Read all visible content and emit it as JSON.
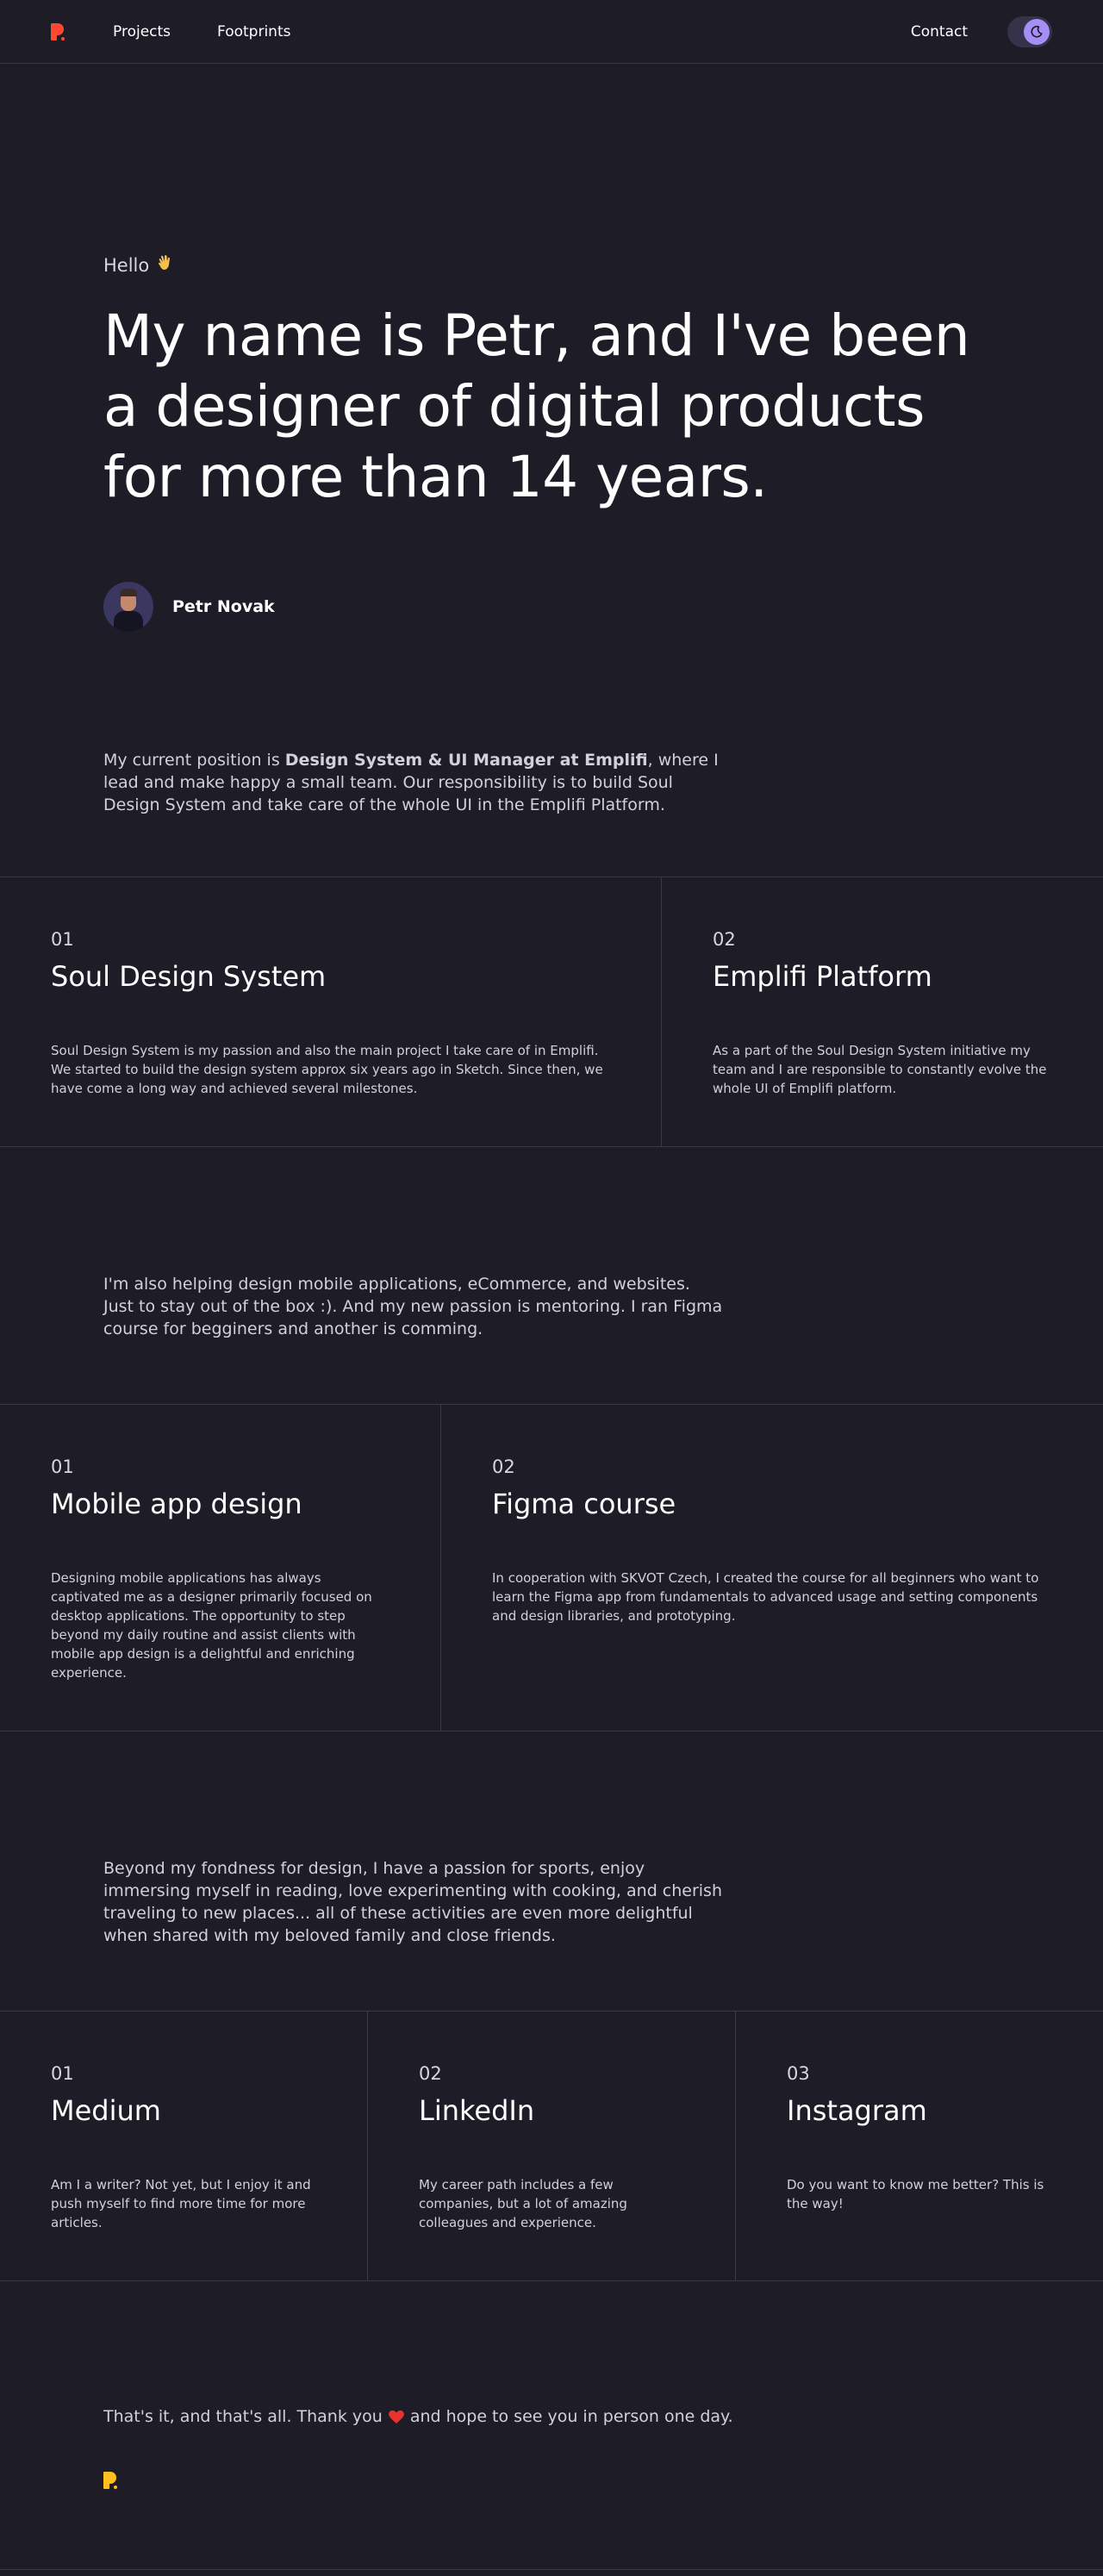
{
  "nav": {
    "links": [
      {
        "label": "Projects"
      },
      {
        "label": "Footprints"
      }
    ],
    "contact_label": "Contact",
    "logo_color": "#ff4830",
    "toggle_color": "#a58ef5"
  },
  "hero": {
    "greeting": "Hello",
    "greeting_icon": "waving-hand-icon",
    "headline": "My name is Petr, and I've been a designer of digital products for more than 14 years.",
    "author_name": "Petr Novak"
  },
  "intro": {
    "before": "My current position is ",
    "bold": "Design System & UI Manager at Emplifi",
    "after": ", where I lead and make happy a small team. Our responsibility is to build Soul Design System and take care of the whole UI in the Emplifi Platform."
  },
  "section1": [
    {
      "num": "01",
      "title": "Soul Design System",
      "text": "Soul Design System is my passion and also the main project I take care of in Emplifi. We started to build the design system approx six years ago in Sketch. Since then, we have come a long way and achieved several milestones."
    },
    {
      "num": "02",
      "title": "Emplifi Platform",
      "text": "As a part of the Soul Design System initiative my team and I are responsible to constantly evolve the whole UI of Emplifi platform."
    }
  ],
  "text2": "I'm also helping design mobile applications, eCommerce, and websites. Just to stay out of the box :). And my new passion is mentoring. I ran Figma course for begginers and another is comming.",
  "section2": [
    {
      "num": "01",
      "title": "Mobile app design",
      "text": "Designing mobile applications has always captivated me as a designer primarily focused on desktop applications. The opportunity to step beyond my daily routine and assist clients with mobile app design is a delightful and enriching experience."
    },
    {
      "num": "02",
      "title": "Figma course",
      "text": "In cooperation with SKVOT Czech, I created the course for all beginners who want to learn the Figma app from fundamentals to advanced usage and setting components and design libraries, and prototyping."
    }
  ],
  "text3": "Beyond my fondness for design, I have a passion for sports, enjoy immersing myself in reading, love experimenting with cooking, and cherish traveling to new places... all of these activities are even more delightful when shared with my beloved family and close friends.",
  "section3": [
    {
      "num": "01",
      "title": "Medium",
      "text": "Am I a writer? Not yet, but I enjoy it and push myself to find more time for more articles."
    },
    {
      "num": "02",
      "title": "LinkedIn",
      "text": "My career path includes a few companies, but a lot of amazing colleagues and experience."
    },
    {
      "num": "03",
      "title": "Instagram",
      "text": "Do you want to know me better? This is the way!"
    }
  ],
  "ending": {
    "before": "That's it, and that's all. Thank you",
    "after": "and hope to see you in person one day.",
    "heart_icon": "heart-icon",
    "logo_color": "#ffbf1f"
  }
}
